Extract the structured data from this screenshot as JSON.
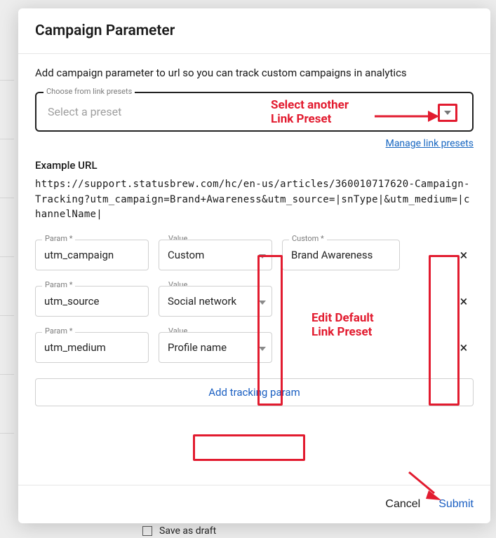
{
  "header": {
    "title": "Campaign Parameter"
  },
  "subtitle": "Add campaign parameter to url so you can track custom campaigns in analytics",
  "preset": {
    "legend": "Choose from link presets",
    "placeholder": "Select a preset"
  },
  "manage_link": "Manage link presets",
  "example": {
    "heading": "Example URL",
    "url": "https://support.statusbrew.com/hc/en-us/articles/360010717620-Campaign-Tracking?utm_campaign=Brand+Awareness&utm_source=|snType|&utm_medium=|channelName|"
  },
  "labels": {
    "param_req": "Param *",
    "value": "Value",
    "custom_req": "Custom *"
  },
  "rows": [
    {
      "param": "utm_campaign",
      "value": "Custom",
      "custom": "Brand Awareness"
    },
    {
      "param": "utm_source",
      "value": "Social network",
      "custom": ""
    },
    {
      "param": "utm_medium",
      "value": "Profile name",
      "custom": ""
    }
  ],
  "add_label": "Add tracking param",
  "footer": {
    "cancel": "Cancel",
    "submit": "Submit"
  },
  "annotations": {
    "select_another": "Select another\nLink Preset",
    "edit_default": "Edit Default\nLink Preset"
  },
  "bleed": {
    "save_as_draft": "Save as draft"
  },
  "close_glyph": "×"
}
